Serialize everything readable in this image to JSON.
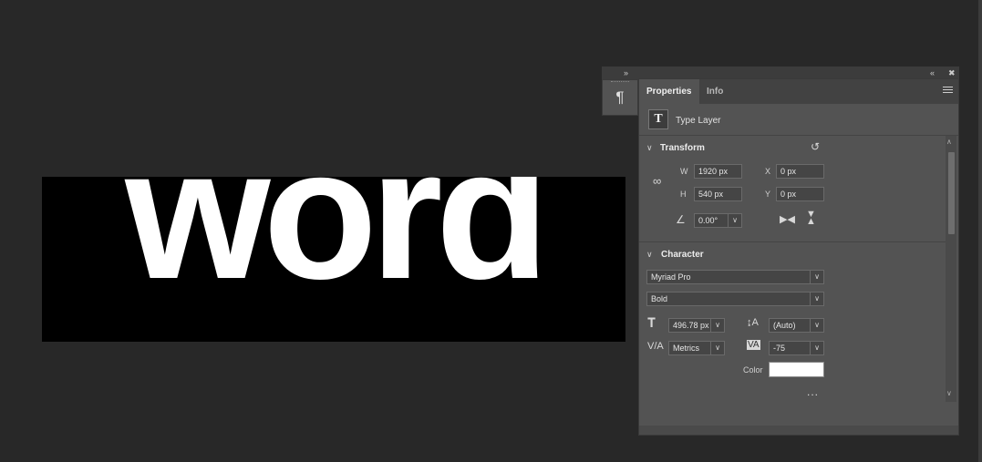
{
  "document": {
    "text": "word"
  },
  "dock": {
    "expand_glyph": "»",
    "collapse_glyph": "«",
    "close_glyph": "✖",
    "paragraph_glyph": "¶"
  },
  "panel": {
    "tabs": [
      {
        "label": "Properties"
      },
      {
        "label": "Info"
      }
    ],
    "type_layer_icon": "T",
    "type_layer_label": "Type Layer",
    "transform": {
      "title": "Transform",
      "w_label": "W",
      "w_value": "1920 px",
      "h_label": "H",
      "h_value": "540 px",
      "x_label": "X",
      "x_value": "0 px",
      "y_label": "Y",
      "y_value": "0 px",
      "angle_value": "0.00°"
    },
    "character": {
      "title": "Character",
      "font_family": "Myriad Pro",
      "font_style": "Bold",
      "font_size": "496.78 px",
      "leading": "(Auto)",
      "kerning": "Metrics",
      "tracking": "-75",
      "color_label": "Color",
      "more": "..."
    }
  },
  "colors": {
    "canvas": "#282828",
    "panel": "#535353",
    "text_color": "#ffffff"
  }
}
